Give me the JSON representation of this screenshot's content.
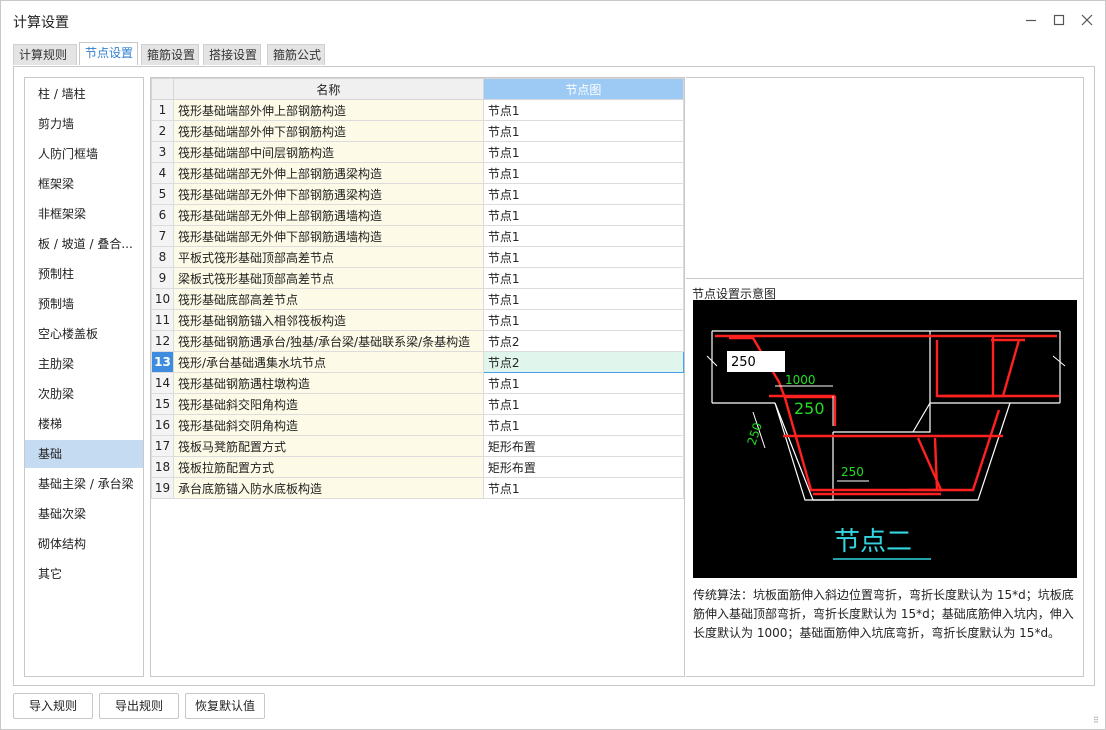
{
  "window": {
    "title": "计算设置"
  },
  "tabs": [
    {
      "label": "计算规则"
    },
    {
      "label": "节点设置"
    },
    {
      "label": "箍筋设置"
    },
    {
      "label": "搭接设置"
    },
    {
      "label": "箍筋公式"
    }
  ],
  "active_tab": "节点设置",
  "categories": [
    {
      "label": "柱 / 墙柱"
    },
    {
      "label": "剪力墙"
    },
    {
      "label": "人防门框墙"
    },
    {
      "label": "框架梁"
    },
    {
      "label": "非框架梁"
    },
    {
      "label": "板 / 坡道 / 叠合..."
    },
    {
      "label": "预制柱"
    },
    {
      "label": "预制墙"
    },
    {
      "label": "空心楼盖板"
    },
    {
      "label": "主肋梁"
    },
    {
      "label": "次肋梁"
    },
    {
      "label": "楼梯"
    },
    {
      "label": "基础"
    },
    {
      "label": "基础主梁 / 承台梁"
    },
    {
      "label": "基础次梁"
    },
    {
      "label": "砌体结构"
    },
    {
      "label": "其它"
    }
  ],
  "selected_category": "基础",
  "table": {
    "headers": {
      "name": "名称",
      "node": "节点图"
    },
    "rows": [
      {
        "idx": "1",
        "name": "筏形基础端部外伸上部钢筋构造",
        "node": "节点1"
      },
      {
        "idx": "2",
        "name": "筏形基础端部外伸下部钢筋构造",
        "node": "节点1"
      },
      {
        "idx": "3",
        "name": "筏形基础端部中间层钢筋构造",
        "node": "节点1"
      },
      {
        "idx": "4",
        "name": "筏形基础端部无外伸上部钢筋遇梁构造",
        "node": "节点1"
      },
      {
        "idx": "5",
        "name": "筏形基础端部无外伸下部钢筋遇梁构造",
        "node": "节点1"
      },
      {
        "idx": "6",
        "name": "筏形基础端部无外伸上部钢筋遇墙构造",
        "node": "节点1"
      },
      {
        "idx": "7",
        "name": "筏形基础端部无外伸下部钢筋遇墙构造",
        "node": "节点1"
      },
      {
        "idx": "8",
        "name": "平板式筏形基础顶部高差节点",
        "node": "节点1"
      },
      {
        "idx": "9",
        "name": "梁板式筏形基础顶部高差节点",
        "node": "节点1"
      },
      {
        "idx": "10",
        "name": "筏形基础底部高差节点",
        "node": "节点1"
      },
      {
        "idx": "11",
        "name": "筏形基础钢筋锚入相邻筏板构造",
        "node": "节点1"
      },
      {
        "idx": "12",
        "name": "筏形基础钢筋遇承台/独基/承台梁/基础联系梁/条基构造",
        "node": "节点2"
      },
      {
        "idx": "13",
        "name": "筏形/承台基础遇集水坑节点",
        "node": "节点2"
      },
      {
        "idx": "14",
        "name": "筏形基础钢筋遇柱墩构造",
        "node": "节点1"
      },
      {
        "idx": "15",
        "name": "筏形基础斜交阳角构造",
        "node": "节点1"
      },
      {
        "idx": "16",
        "name": "筏形基础斜交阴角构造",
        "node": "节点1"
      },
      {
        "idx": "17",
        "name": "筏板马凳筋配置方式",
        "node": "矩形布置"
      },
      {
        "idx": "18",
        "name": "筏板拉筋配置方式",
        "node": "矩形布置"
      },
      {
        "idx": "19",
        "name": "承台底筋锚入防水底板构造",
        "node": "节点1"
      }
    ],
    "selected_row": "13"
  },
  "diagram": {
    "title": "节点设置示意图",
    "caption": "节点二",
    "labels": {
      "input_value": "250",
      "d1000": "1000",
      "d250_big": "250",
      "d250_slope": "250",
      "d250_bottom": "250"
    },
    "description": "传统算法：坑板面筋伸入斜边位置弯折，弯折长度默认为 15*d；坑板底筋伸入基础顶部弯折，弯折长度默认为 15*d；基础底筋伸入坑内，伸入长度默认为 1000；基础面筋伸入坑底弯折，弯折长度默认为 15*d。"
  },
  "buttons": {
    "import": "导入规则",
    "export": "导出规则",
    "restore": "恢复默认值"
  },
  "colors": {
    "accent": "#2f7fd0",
    "header_node": "#9ccaf5",
    "selected_row_index": "#3d8ce0",
    "selected_cell": "#e0f5ec",
    "name_cell": "#fdfbe7",
    "rebar": "#ff2020",
    "dimension": "#22dd22",
    "caption": "#33d6e0"
  }
}
